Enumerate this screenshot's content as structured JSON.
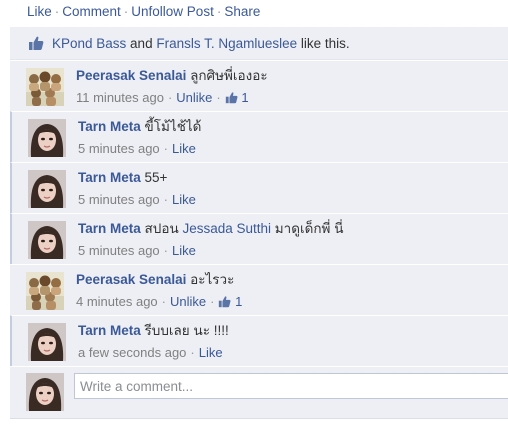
{
  "post_actions": {
    "like": "Like",
    "comment": "Comment",
    "unfollow": "Unfollow Post",
    "share": "Share",
    "separator": "·"
  },
  "likes": {
    "person1": "KPond Bass",
    "and": " and ",
    "person2": "Fransls T. Ngamlueslee",
    "suffix": " like this."
  },
  "comments": [
    {
      "author": "Peerasak Senalai",
      "text": "ลูกศิษพี่เองอะ",
      "time": "11 minutes ago",
      "action": "Unlike",
      "like_count": "1",
      "avatar": "group-photo"
    },
    {
      "author": "Tarn Meta",
      "text": "ขี้โม้ไช้ได้",
      "time": "5 minutes ago",
      "action": "Like",
      "avatar": "girl-photo"
    },
    {
      "author": "Tarn Meta",
      "text": "55+",
      "time": "5 minutes ago",
      "action": "Like",
      "avatar": "girl-photo"
    },
    {
      "author": "Tarn Meta",
      "text_before": "สปอน ",
      "mention": "Jessada Sutthi",
      "text_after": " มาดูเด็กพี่ นี่",
      "time": "5 minutes ago",
      "action": "Like",
      "avatar": "girl-photo"
    },
    {
      "author": "Peerasak Senalai",
      "text": "อะไรวะ",
      "time": "4 minutes ago",
      "action": "Unlike",
      "like_count": "1",
      "avatar": "group-photo"
    },
    {
      "author": "Tarn Meta",
      "text": "รีบบเลย นะ !!!!",
      "time": "a few seconds ago",
      "action": "Like",
      "avatar": "girl-photo"
    }
  ],
  "composer": {
    "placeholder": "Write a comment..."
  },
  "colors": {
    "link": "#3b5998",
    "panel_bg": "#edeff4",
    "muted": "#808080"
  }
}
